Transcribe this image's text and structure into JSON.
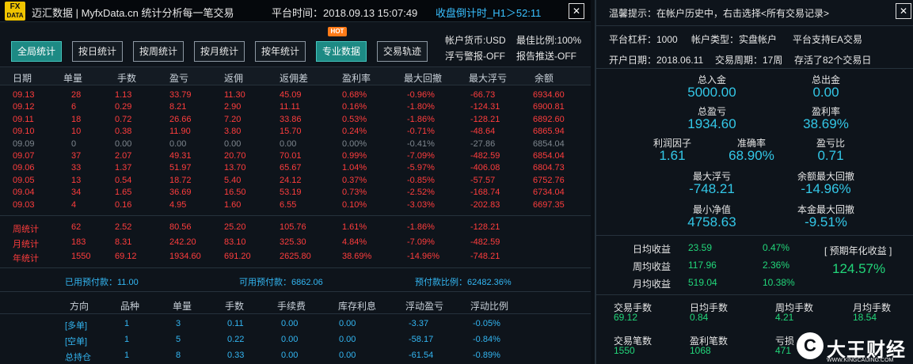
{
  "titlebar": {
    "logo_line1": "FX",
    "logo_line2": "DATA",
    "brand": "迈汇数据 | MyfxData.cn  统计分析每一笔交易",
    "platform_time": "平台时间：2018.09.13 15:07:49",
    "countdown": "收盘倒计时_H1＞52:11",
    "close_icon": "close-icon"
  },
  "tabs": [
    {
      "label": "全局统计",
      "active": true
    },
    {
      "label": "按日统计",
      "active": false
    },
    {
      "label": "按周统计",
      "active": false
    },
    {
      "label": "按月统计",
      "active": false
    },
    {
      "label": "按年统计",
      "active": false
    },
    {
      "label": "专业数据",
      "active": true
    },
    {
      "label": "交易轨迹",
      "active": false
    }
  ],
  "hot_badge": "HOT",
  "account": {
    "currency": "帐户货币:USD",
    "ratio": "最佳比例:100%",
    "float_alert": "浮亏警报-OFF",
    "report_push": "报告推送-OFF"
  },
  "table_headers": [
    "日期",
    "单量",
    "手数",
    "盈亏",
    "返佣",
    "返佣差",
    "盈利率",
    "最大回撤",
    "最大浮亏",
    "余额"
  ],
  "daily_rows": [
    {
      "status": "red",
      "cells": [
        "09.13",
        "28",
        "1.13",
        "33.79",
        "11.30",
        "45.09",
        "0.68%",
        "-0.96%",
        "-66.73",
        "6934.60"
      ]
    },
    {
      "status": "red",
      "cells": [
        "09.12",
        "6",
        "0.29",
        "8.21",
        "2.90",
        "11.11",
        "0.16%",
        "-1.80%",
        "-124.31",
        "6900.81"
      ]
    },
    {
      "status": "red",
      "cells": [
        "09.11",
        "18",
        "0.72",
        "26.66",
        "7.20",
        "33.86",
        "0.53%",
        "-1.86%",
        "-128.21",
        "6892.60"
      ]
    },
    {
      "status": "red",
      "cells": [
        "09.10",
        "10",
        "0.38",
        "11.90",
        "3.80",
        "15.70",
        "0.24%",
        "-0.71%",
        "-48.64",
        "6865.94"
      ]
    },
    {
      "status": "grey",
      "cells": [
        "09.09",
        "0",
        "0.00",
        "0.00",
        "0.00",
        "0.00",
        "0.00%",
        "-0.41%",
        "-27.86",
        "6854.04"
      ]
    },
    {
      "status": "red",
      "cells": [
        "09.07",
        "37",
        "2.07",
        "49.31",
        "20.70",
        "70.01",
        "0.99%",
        "-7.09%",
        "-482.59",
        "6854.04"
      ]
    },
    {
      "status": "red",
      "cells": [
        "09.06",
        "33",
        "1.37",
        "51.97",
        "13.70",
        "65.67",
        "1.04%",
        "-5.97%",
        "-406.08",
        "6804.73"
      ]
    },
    {
      "status": "red",
      "cells": [
        "09.05",
        "13",
        "0.54",
        "18.72",
        "5.40",
        "24.12",
        "0.37%",
        "-0.85%",
        "-57.57",
        "6752.76"
      ]
    },
    {
      "status": "red",
      "cells": [
        "09.04",
        "34",
        "1.65",
        "36.69",
        "16.50",
        "53.19",
        "0.73%",
        "-2.52%",
        "-168.74",
        "6734.04"
      ]
    },
    {
      "status": "red",
      "cells": [
        "09.03",
        "4",
        "0.16",
        "4.95",
        "1.60",
        "6.55",
        "0.10%",
        "-3.03%",
        "-202.83",
        "6697.35"
      ]
    }
  ],
  "summary_rows": [
    {
      "cells": [
        "周统计",
        "62",
        "2.52",
        "80.56",
        "25.20",
        "105.76",
        "1.61%",
        "-1.86%",
        "-128.21"
      ]
    },
    {
      "cells": [
        "月统计",
        "183",
        "8.31",
        "242.20",
        "83.10",
        "325.30",
        "4.84%",
        "-7.09%",
        "-482.59"
      ]
    },
    {
      "cells": [
        "年统计",
        "1550",
        "69.12",
        "1934.60",
        "691.20",
        "2625.80",
        "38.69%",
        "-14.96%",
        "-748.21"
      ]
    }
  ],
  "margin_info": {
    "used": "已用预付款：11.00",
    "available": "可用预付款：6862.06",
    "ratio": "预付款比例：62482.36%"
  },
  "position_headers": [
    "方向",
    "品种",
    "单量",
    "手数",
    "手续费",
    "库存利息",
    "浮动盈亏",
    "浮动比例"
  ],
  "position_rows": [
    {
      "cells": [
        "[多单]",
        "1",
        "3",
        "0.11",
        "0.00",
        "0.00",
        "-3.37",
        "-0.05%"
      ]
    },
    {
      "cells": [
        "[空单]",
        "1",
        "5",
        "0.22",
        "0.00",
        "0.00",
        "-58.17",
        "-0.84%"
      ]
    },
    {
      "cells": [
        "总持仓",
        "1",
        "8",
        "0.33",
        "0.00",
        "0.00",
        "-61.54",
        "-0.89%"
      ]
    }
  ],
  "right": {
    "tip": "温馨提示：在帐户历史中，右击选择<所有交易记录>",
    "leverage": "平台杠杆：1000",
    "acct_type": "帐户类型：实盘帐户",
    "ea_support": "平台支持EA交易",
    "open_date": "开户日期：2018.06.11",
    "trade_period": "交易周期：17周",
    "survived": "存活了82个交易日",
    "stats": [
      {
        "label": "总入金",
        "value": "5000.00"
      },
      {
        "label": "总出金",
        "value": "0.00"
      },
      {
        "label": "总盈亏",
        "value": "1934.60"
      },
      {
        "label": "盈利率",
        "value": "38.69%"
      },
      {
        "label": "利润因子",
        "value": "1.61"
      },
      {
        "label": "准确率",
        "value": "68.90%"
      },
      {
        "label": "盈亏比",
        "value": "0.71"
      },
      {
        "label": "最大浮亏",
        "value": "-748.21"
      },
      {
        "label": "余额最大回撤",
        "value": "-14.96%"
      },
      {
        "label": "最小净值",
        "value": "4758.63"
      },
      {
        "label": "本金最大回撤",
        "value": "-9.51%"
      }
    ],
    "yield_rows": [
      {
        "label": "日均收益",
        "value": "23.59",
        "pct": "0.47%"
      },
      {
        "label": "周均收益",
        "value": "117.96",
        "pct": "2.36%"
      },
      {
        "label": "月均收益",
        "value": "519.04",
        "pct": "10.38%"
      }
    ],
    "annual_label": "[ 预期年化收益 ]",
    "annual_value": "124.57%",
    "lots": [
      {
        "label": "交易手数",
        "value": "69.12"
      },
      {
        "label": "日均手数",
        "value": "0.84"
      },
      {
        "label": "周均手数",
        "value": "4.21"
      },
      {
        "label": "月均手数",
        "value": "18.54"
      }
    ],
    "counts": [
      {
        "label": "交易笔数",
        "value": "1550"
      },
      {
        "label": "盈利笔数",
        "value": "1068"
      },
      {
        "label": "亏损",
        "value": "471"
      }
    ]
  },
  "watermark": {
    "logo": "C",
    "name": "大王财经",
    "url": "WWW.KINGCAIJING.COM"
  },
  "colors": {
    "profit": "#ff3d3d",
    "accent": "#33b6f2",
    "active_tab": "#1d8a84",
    "positive": "#22d67a"
  }
}
